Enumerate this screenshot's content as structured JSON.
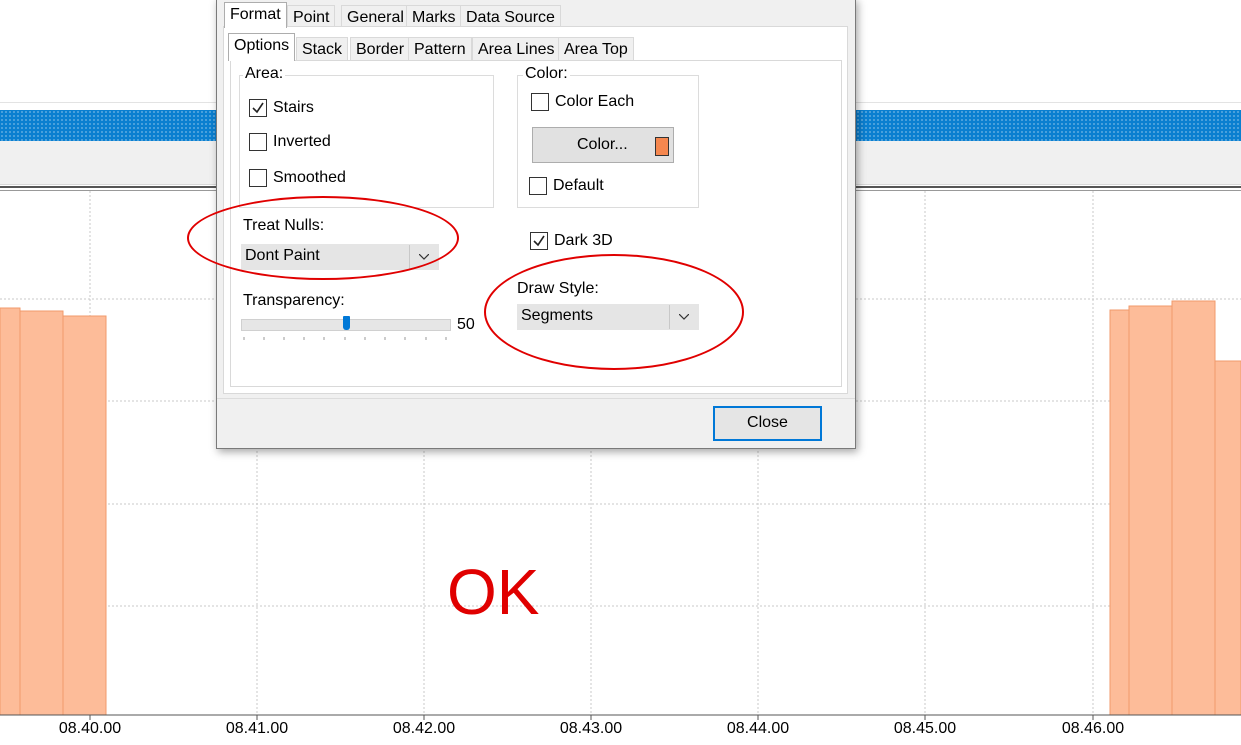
{
  "background": {
    "x_tick_labels": [
      "08.40.00",
      "08.41.00",
      "08.42.00",
      "08.43.00",
      "08.44.00",
      "08.45.00",
      "08.46.00"
    ],
    "overlay_text": "OK",
    "colors": {
      "toolbar_blue": "#0a7fd0",
      "area_fill": "#fdbc99",
      "area_stroke": "#f19a6b",
      "annotation_red": "#e00000"
    }
  },
  "dialog": {
    "top_tabs": [
      "Format",
      "Point",
      "General",
      "Marks",
      "Data Source"
    ],
    "top_tab_selected": "Format",
    "sub_tabs": [
      "Options",
      "Stack",
      "Border",
      "Pattern",
      "Area Lines",
      "Area Top"
    ],
    "sub_tab_selected": "Options",
    "area": {
      "label": "Area:",
      "stairs": {
        "label": "Stairs",
        "checked": true
      },
      "inverted": {
        "label": "Inverted",
        "checked": false
      },
      "smoothed": {
        "label": "Smoothed",
        "checked": false
      }
    },
    "color": {
      "label": "Color:",
      "color_each": {
        "label": "Color Each",
        "checked": false
      },
      "color_button_label": "Color...",
      "swatch_color": "#f5874f",
      "default": {
        "label": "Default",
        "checked": false
      }
    },
    "treat_nulls": {
      "label": "Treat Nulls:",
      "value": "Dont Paint"
    },
    "dark_3d": {
      "label": "Dark 3D",
      "checked": true
    },
    "transparency": {
      "label": "Transparency:",
      "value": "50",
      "fraction": 0.5
    },
    "draw_style": {
      "label": "Draw Style:",
      "value": "Segments"
    },
    "close_label": "Close"
  }
}
